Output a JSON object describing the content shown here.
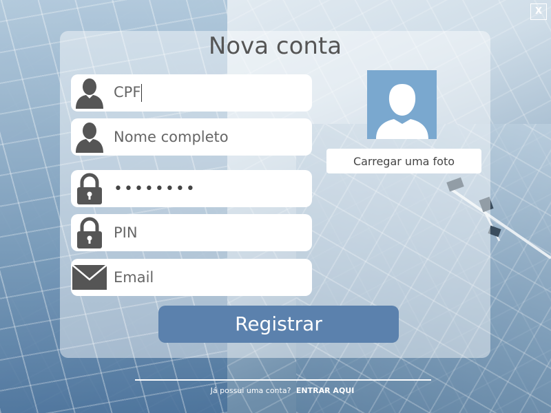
{
  "window": {
    "close_label": "X"
  },
  "title": "Nova conta",
  "fields": {
    "cpf": {
      "value": "CPF"
    },
    "name": {
      "value": "Nome completo"
    },
    "password": {
      "value": "••••••••"
    },
    "pin": {
      "value": "PIN"
    },
    "email": {
      "value": "Email"
    }
  },
  "photo": {
    "upload_label": "Carregar uma foto"
  },
  "register_label": "Registrar",
  "footer": {
    "question": "Já possui uma conta?",
    "link": "ENTRAR AQUI"
  },
  "colors": {
    "accent": "#5b81ad",
    "avatar_bg": "#7aa8cf",
    "icon": "#555555"
  },
  "icons": {
    "cpf": "user-icon",
    "name": "user-icon",
    "password": "lock-icon",
    "pin": "lock-icon",
    "email": "envelope-icon",
    "avatar": "user-silhouette-icon"
  }
}
